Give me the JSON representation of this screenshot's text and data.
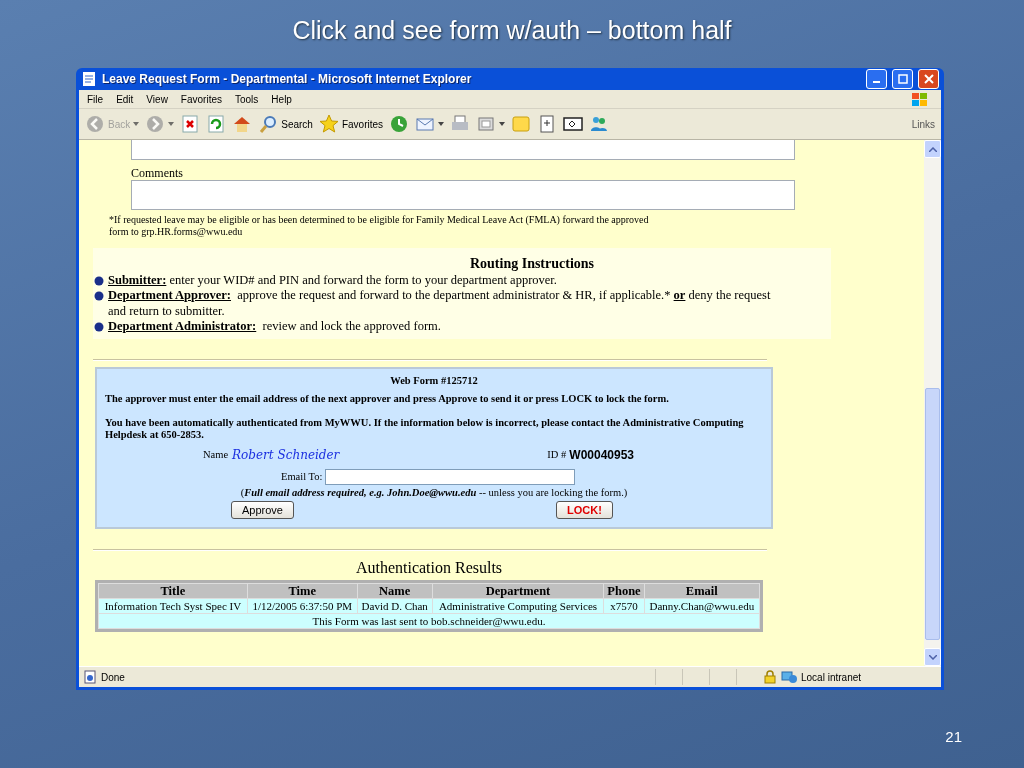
{
  "slide": {
    "title": "Click and see form w/auth – bottom half",
    "page_number": "21"
  },
  "window": {
    "title": "Leave Request Form - Departmental - Microsoft Internet Explorer",
    "menu": [
      "File",
      "Edit",
      "View",
      "Favorites",
      "Tools",
      "Help"
    ],
    "toolbar": [
      {
        "kind": "back",
        "label": "Back",
        "disabled": true,
        "dropdown": true
      },
      {
        "kind": "forward",
        "disabled": true,
        "dropdown": true
      },
      {
        "kind": "stop",
        "disabled": false,
        "dropdown": false
      },
      {
        "kind": "refresh",
        "disabled": false,
        "dropdown": false
      },
      {
        "kind": "home",
        "disabled": false,
        "dropdown": false
      },
      {
        "kind": "search",
        "label": "Search",
        "disabled": false,
        "dropdown": false
      },
      {
        "kind": "favorites",
        "label": "Favorites",
        "disabled": false,
        "dropdown": false
      },
      {
        "kind": "history",
        "disabled": false,
        "dropdown": false
      },
      {
        "kind": "mail",
        "disabled": false,
        "dropdown": true
      },
      {
        "kind": "print",
        "disabled": false,
        "dropdown": false
      },
      {
        "kind": "edit",
        "disabled": false,
        "dropdown": true
      },
      {
        "kind": "note",
        "disabled": false,
        "dropdown": false
      },
      {
        "kind": "research",
        "disabled": false,
        "dropdown": false
      },
      {
        "kind": "discuss",
        "disabled": false,
        "dropdown": false
      },
      {
        "kind": "messenger",
        "disabled": false,
        "dropdown": false
      }
    ],
    "links": "Links"
  },
  "page": {
    "comments_label": "Comments",
    "note": "*If requested leave may be eligible or has been determined to be eligible for Family Medical Leave Act (FMLA) forward the approved form to grp.HR.forms@wwu.edu",
    "routing": {
      "title": "Routing Instructions",
      "items": [
        {
          "text": "**Submitter:** enter your WID# and PIN and forward the form to your department approver."
        },
        {
          "text": "**Department Approver:**  approve the request and forward to the department administrator & HR, if applicable.* **or** deny the request and return to submitter."
        },
        {
          "text": "**Department Administrator:**  review and lock the approved form."
        }
      ]
    },
    "webform": {
      "title": "Web Form #125712",
      "instructions": [
        "The approver must enter the email address of the next approver and press Approve to send it or press LOCK to lock the form.",
        "You have been automatically authenticated from MyWWU. If the information below is incorrect, please contact the Administrative Computing Helpdesk at 650-2853."
      ],
      "name_label": "Name",
      "name": "Robert Schneider",
      "id_label": "ID #",
      "id": "W00040953",
      "email_label": "Email To:",
      "hint": "(*Full email address required, e.g. John.Doe@wwu.edu*  -- unless you are locking the form.)",
      "approve": "Approve",
      "lock": "LOCK!"
    },
    "auth": {
      "title": "Authentication Results",
      "columns": [
        "Title",
        "Time",
        "Name",
        "Department",
        "Phone",
        "Email"
      ],
      "rows": [
        [
          "Information Tech Syst Spec IV",
          "1/12/2005 6:37:50 PM",
          "David D. Chan",
          "Administrative Computing Services",
          "x7570",
          "Danny.Chan@wwu.edu"
        ]
      ],
      "footer": "This Form was last sent to bob.schneider@wwu.edu."
    }
  },
  "status_bar": {
    "text": "Done",
    "zone": "Local intranet"
  }
}
